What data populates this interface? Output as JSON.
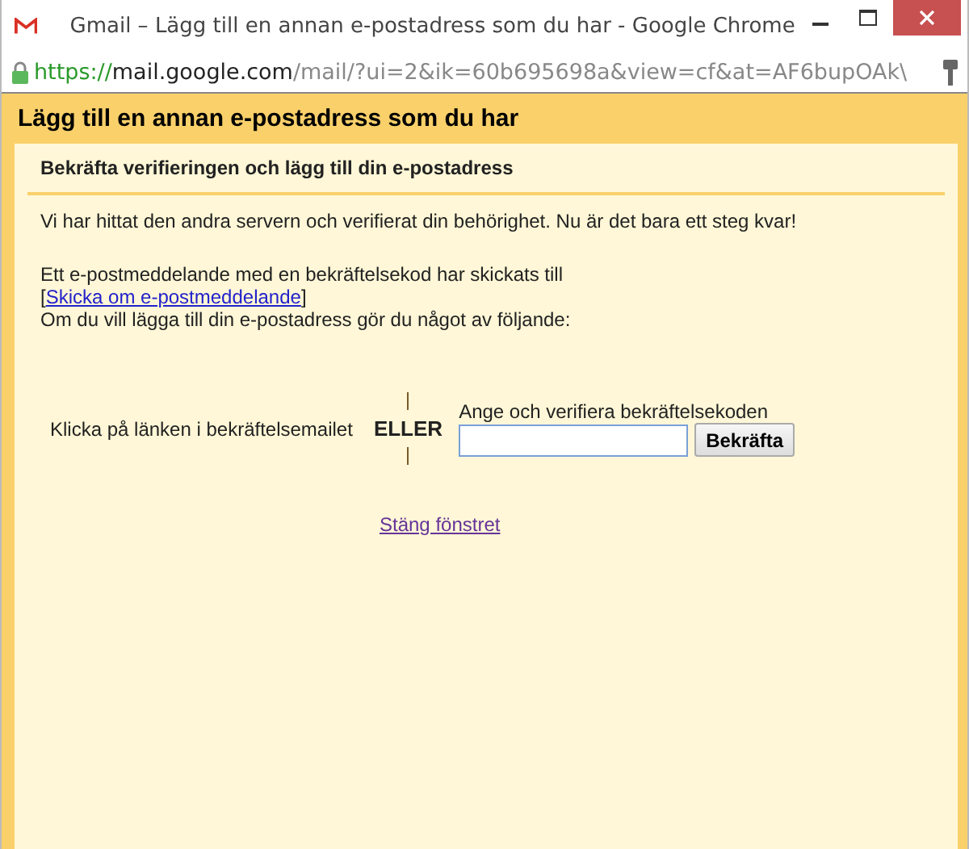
{
  "window": {
    "title": "Gmail – Lägg till en annan e-postadress som du har - Google Chrome"
  },
  "address_bar": {
    "scheme": "https://",
    "host": "mail.google.com",
    "path": "/mail/?ui=2&ik=60b695698a&view=cf&at=AF6bupOAk\\"
  },
  "dialog": {
    "title": "Lägg till en annan e-postadress som du har",
    "subtitle": "Bekräfta verifieringen och lägg till din e-postadress",
    "intro": "Vi har hittat den andra servern och verifierat din behörighet. Nu är det bara ett steg kvar!",
    "sent_text": "Ett e-postmeddelande med en bekräftelsekod har skickats till",
    "resend_open": "[",
    "resend_link": "Skicka om e-postmeddelande",
    "resend_close": "]",
    "instruction": "Om du vill lägga till din e-postadress gör du något av följande:",
    "option_link_text": "Klicka på länken i bekräftelsemailet",
    "separator": "ELLER",
    "code_label": "Ange och verifiera bekräftelsekoden",
    "confirm_button": "Bekräfta",
    "close_link": "Stäng fönstret"
  }
}
